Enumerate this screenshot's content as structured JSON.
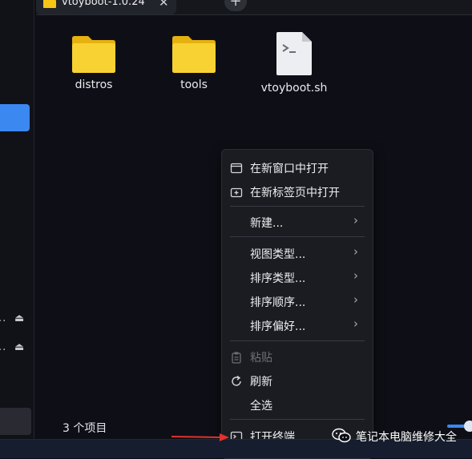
{
  "tab": {
    "title": "vtoyboot-1.0.24",
    "close_glyph": "✕",
    "new_tab_glyph": "+"
  },
  "files": [
    {
      "name": "distros",
      "icon": "folder-icon"
    },
    {
      "name": "tools",
      "icon": "folder-icon"
    },
    {
      "name": "vtoyboot.sh",
      "icon": "script-file-icon"
    }
  ],
  "status": {
    "item_count": "3 个项目"
  },
  "sidebar": {
    "dots": "..",
    "eject_glyph": "⏏"
  },
  "context_menu": {
    "items": [
      {
        "label": "在新窗口中打开",
        "icon": "new-window-icon"
      },
      {
        "label": "在新标签页中打开",
        "icon": "new-tab-icon"
      },
      {
        "label": "新建...",
        "submenu": true
      },
      {
        "label": "视图类型...",
        "submenu": true
      },
      {
        "label": "排序类型...",
        "submenu": true
      },
      {
        "label": "排序顺序...",
        "submenu": true
      },
      {
        "label": "排序偏好...",
        "submenu": true
      },
      {
        "label": "粘贴",
        "icon": "clipboard-icon",
        "disabled": true
      },
      {
        "label": "刷新",
        "icon": "refresh-icon"
      },
      {
        "label": "全选"
      },
      {
        "label": "打开终端",
        "icon": "terminal-icon"
      }
    ],
    "submenu_arrow": "›"
  },
  "watermark": {
    "text": "笔记本电脑维修大全"
  },
  "colors": {
    "accent": "#3a88f0",
    "folder": "#f5c518",
    "arrow": "#e0322e"
  }
}
